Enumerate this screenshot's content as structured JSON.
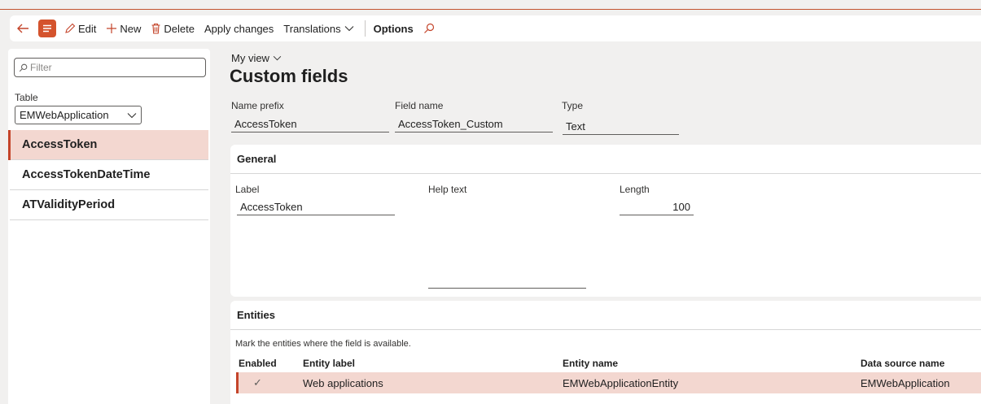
{
  "toolbar": {
    "edit_label": "Edit",
    "new_label": "New",
    "delete_label": "Delete",
    "apply_label": "Apply changes",
    "translations_label": "Translations",
    "options_label": "Options"
  },
  "leftpane": {
    "filter_placeholder": "Filter",
    "table_label": "Table",
    "table_value": "EMWebApplication",
    "items": [
      {
        "label": "AccessToken"
      },
      {
        "label": "AccessTokenDateTime"
      },
      {
        "label": "ATValidityPeriod"
      }
    ]
  },
  "main": {
    "view_label": "My view",
    "title": "Custom fields",
    "name_prefix_label": "Name prefix",
    "name_prefix_value": "AccessToken",
    "field_name_label": "Field name",
    "field_name_value": "AccessToken_Custom",
    "type_label": "Type",
    "type_value": "Text"
  },
  "general": {
    "header": "General",
    "label_label": "Label",
    "label_value": "AccessToken",
    "help_label": "Help text",
    "help_value": "",
    "length_label": "Length",
    "length_value": "100"
  },
  "entities": {
    "header": "Entities",
    "instruction": "Mark the entities where the field is available.",
    "columns": [
      "Enabled",
      "Entity label",
      "Entity name",
      "Data source name"
    ],
    "rows": [
      {
        "enabled": "✓",
        "entity_label": "Web applications",
        "entity_name": "EMWebApplicationEntity",
        "data_source": "EMWebApplication"
      }
    ]
  },
  "colors": {
    "accent": "#d4532d",
    "selection": "#f3d7d0"
  }
}
